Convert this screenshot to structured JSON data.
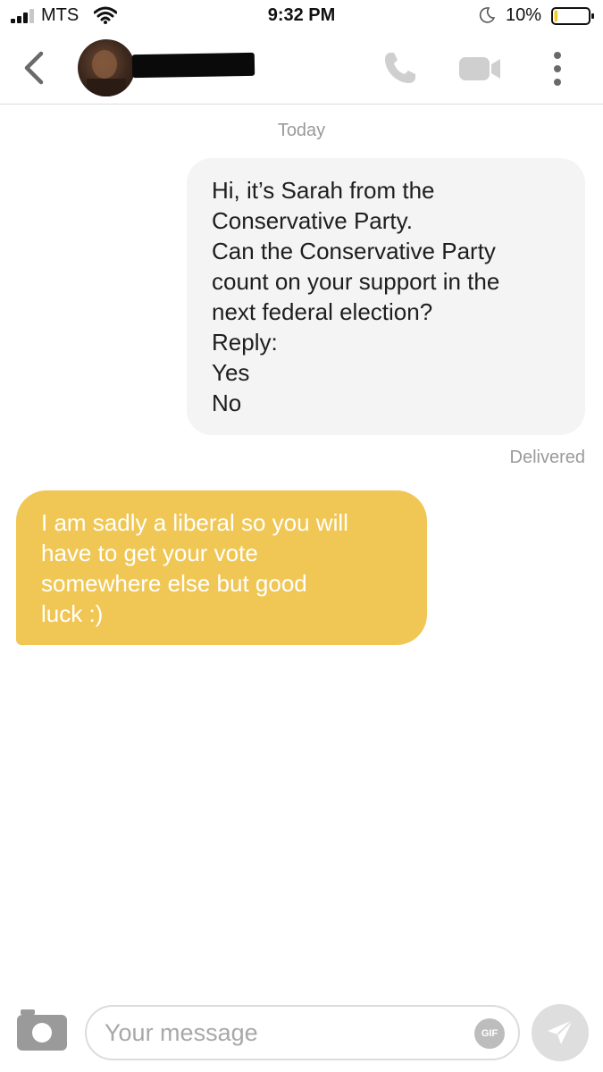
{
  "status_bar": {
    "carrier": "MTS",
    "time": "9:32 PM",
    "battery_percent": "10%",
    "battery_level": 0.1,
    "icons": [
      "signal-icon",
      "wifi-icon",
      "moon-icon",
      "battery-icon"
    ]
  },
  "header": {
    "icons": [
      "back-chevron-icon",
      "phone-icon",
      "video-camera-icon",
      "more-vertical-icon"
    ]
  },
  "conversation": {
    "date_label": "Today",
    "outgoing_message": {
      "lines": [
        "Hi, it’s Sarah from the",
        "Conservative Party.",
        "Can the Conservative Party",
        "count on your support in the",
        "next federal election?",
        "Reply:",
        "Yes",
        "No"
      ],
      "status": "Delivered"
    },
    "incoming_message": {
      "lines": [
        "I am sadly a liberal so you will",
        "have to get your vote",
        "somewhere else but good",
        "luck :)"
      ]
    }
  },
  "composer": {
    "placeholder": "Your message",
    "value": "",
    "gif_label": "GIF",
    "icons": [
      "camera-icon",
      "send-icon"
    ]
  },
  "colors": {
    "incoming_bubble": "#f0c754",
    "outgoing_bubble": "#f4f4f4",
    "accent_muted": "#9a9a9a"
  }
}
